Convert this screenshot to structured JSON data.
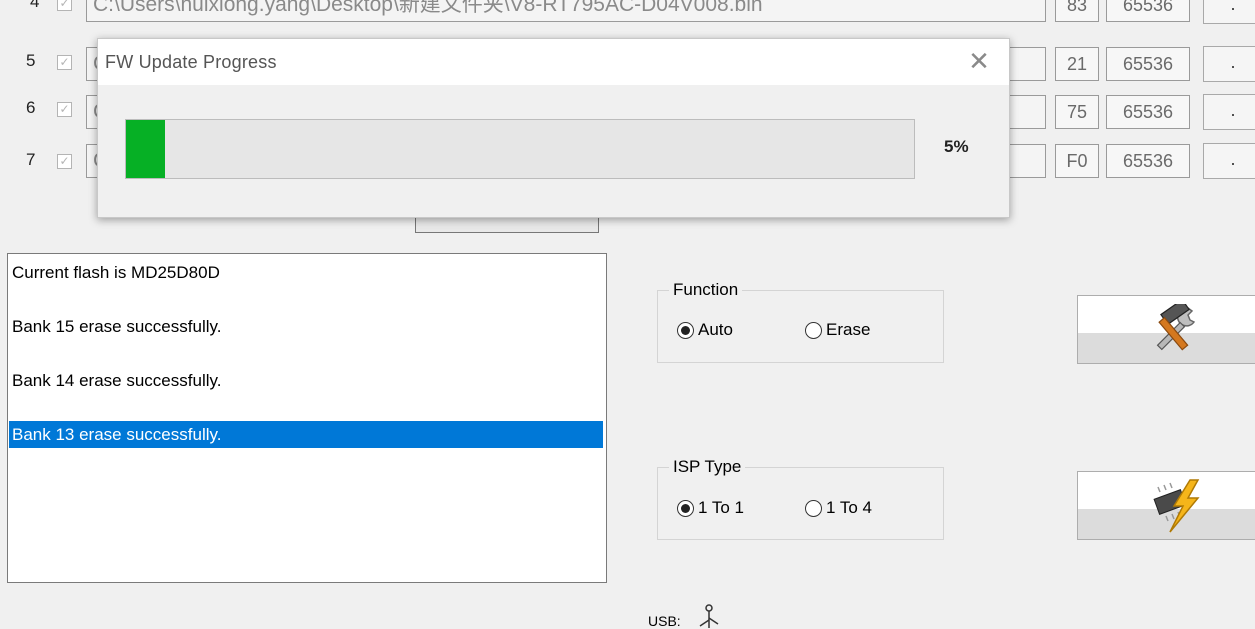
{
  "file_rows": [
    {
      "num": "4",
      "path": "C:\\Users\\huixiong.yang\\Desktop\\新建文件夹\\V8-RT795AC-D04V008.bin",
      "code": "83",
      "size": "65536",
      "browse": "."
    },
    {
      "num": "5",
      "path": "C",
      "code": "21",
      "size": "65536",
      "browse": "."
    },
    {
      "num": "6",
      "path": "C",
      "code": "75",
      "size": "65536",
      "browse": "."
    },
    {
      "num": "7",
      "path": "C",
      "code": "F0",
      "size": "65536",
      "browse": "."
    }
  ],
  "progress_dialog": {
    "title": "FW Update Progress",
    "close_glyph": "✕",
    "progress": 0.05,
    "percent_label": "5%",
    "bar_color": "#06b025"
  },
  "log": {
    "items": [
      "Current flash is MD25D80D",
      "Bank 15 erase successfully.",
      "Bank 14 erase successfully.",
      "Bank 13 erase successfully."
    ],
    "selected_index": 3,
    "selected_color": "#0078d7"
  },
  "function_group": {
    "label": "Function",
    "options": [
      "Auto",
      "Erase"
    ],
    "selected": "Auto"
  },
  "isp_group": {
    "label": "ISP Type",
    "options": [
      "1 To 1",
      "1 To 4"
    ],
    "selected": "1 To 1"
  },
  "buttons": {
    "tools_icon": "hammer-wrench-icon",
    "flash_icon": "chip-lightning-icon"
  },
  "usb_label": "USB:"
}
